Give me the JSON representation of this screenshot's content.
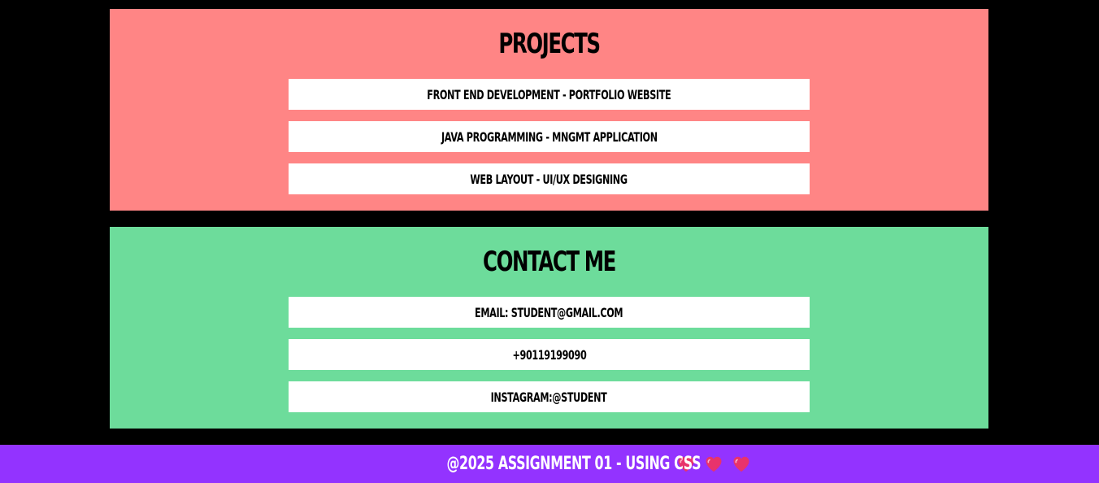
{
  "projects": {
    "title": "PROJECTS",
    "items": [
      {
        "label": "FRONT END DEVELOPMENT - PORTFOLIO WEBSITE"
      },
      {
        "label": "JAVA PROGRAMMING - MNGMT APPLICATION"
      },
      {
        "label": "WEB LAYOUT - UI/UX DESIGNING"
      }
    ]
  },
  "contact": {
    "title": "CONTACT ME",
    "items": [
      {
        "label": "EMAIL: STUDENT@GMAIL.COM"
      },
      {
        "label": "+90119199090"
      },
      {
        "label": "INSTAGRAM:@STUDENT"
      }
    ]
  },
  "footer": {
    "text": "@2025 ASSIGNMENT 01 - USING CSS",
    "icons": [
      "heart-icon",
      "heart-icon",
      "heart-icon"
    ]
  },
  "colors": {
    "background": "#000000",
    "projects_bg": "#ff8585",
    "contact_bg": "#6ddc9b",
    "item_bg": "#ffffff",
    "footer_bg": "#9333ff",
    "heart": "#e8336b"
  }
}
